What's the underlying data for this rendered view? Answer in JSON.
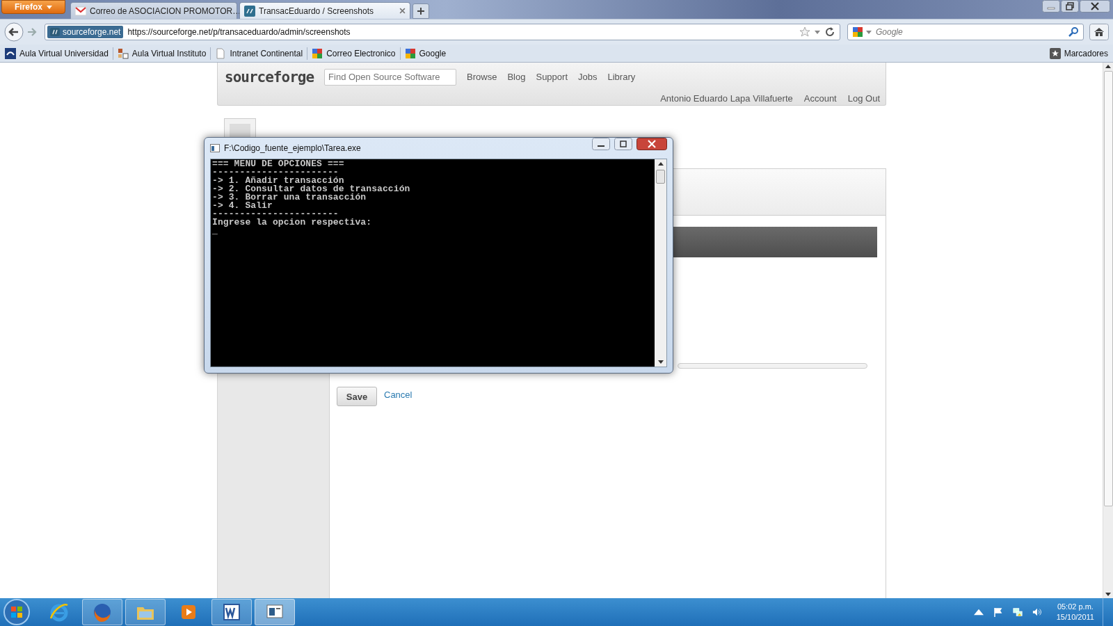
{
  "browser": {
    "menu_button": "Firefox",
    "tabs": [
      {
        "title": "Correo de ASOCIACION PROMOTOR…",
        "kind": "mail",
        "selected": false
      },
      {
        "title": "TransacEduardo / Screenshots",
        "kind": "sf",
        "selected": true
      }
    ],
    "identity": "sourceforge.net",
    "url": "https://sourceforge.net/p/transaceduardo/admin/screenshots",
    "search_placeholder": "Google",
    "bookmarks": [
      {
        "label": "Aula Virtual Universidad",
        "kind": "uni"
      },
      {
        "label": "Aula Virtual Instituto",
        "kind": "inst"
      },
      {
        "label": "Intranet Continental",
        "kind": "page"
      },
      {
        "label": "Correo Electronico",
        "kind": "google"
      },
      {
        "label": "Google",
        "kind": "google"
      }
    ],
    "bookmarks_menu": "Marcadores"
  },
  "site": {
    "logo": "sourceforge",
    "search_placeholder": "Find Open Source Software",
    "nav": [
      "Browse",
      "Blog",
      "Support",
      "Jobs",
      "Library"
    ],
    "user_links": [
      "Antonio Eduardo Lapa Villafuerte",
      "Account",
      "Log Out"
    ]
  },
  "form": {
    "actions": [
      {
        "label": "Save",
        "kind": "button"
      },
      {
        "label": "Cancel",
        "kind": "link"
      }
    ]
  },
  "console": {
    "title": "F:\\Codigo_fuente_ejemplo\\Tarea.exe",
    "lines": [
      "=== MENU DE OPCIONES ===",
      "-----------------------",
      "-> 1. Añadir transacción",
      "-> 2. Consultar datos de transacción",
      "-> 3. Borrar una transacción",
      "-> 4. Salir",
      "-----------------------",
      "Ingrese la opcion respectiva:"
    ],
    "cursor": "_"
  },
  "taskbar": {
    "apps": [
      {
        "kind": "ie",
        "running": false,
        "selected": false
      },
      {
        "kind": "firefox",
        "running": true,
        "selected": false
      },
      {
        "kind": "explorer",
        "running": true,
        "selected": false
      },
      {
        "kind": "media",
        "running": false,
        "selected": false
      },
      {
        "kind": "word",
        "running": true,
        "selected": false
      },
      {
        "kind": "console",
        "running": true,
        "selected": true
      }
    ],
    "time": "05:02 p.m.",
    "date": "15/10/2011"
  }
}
